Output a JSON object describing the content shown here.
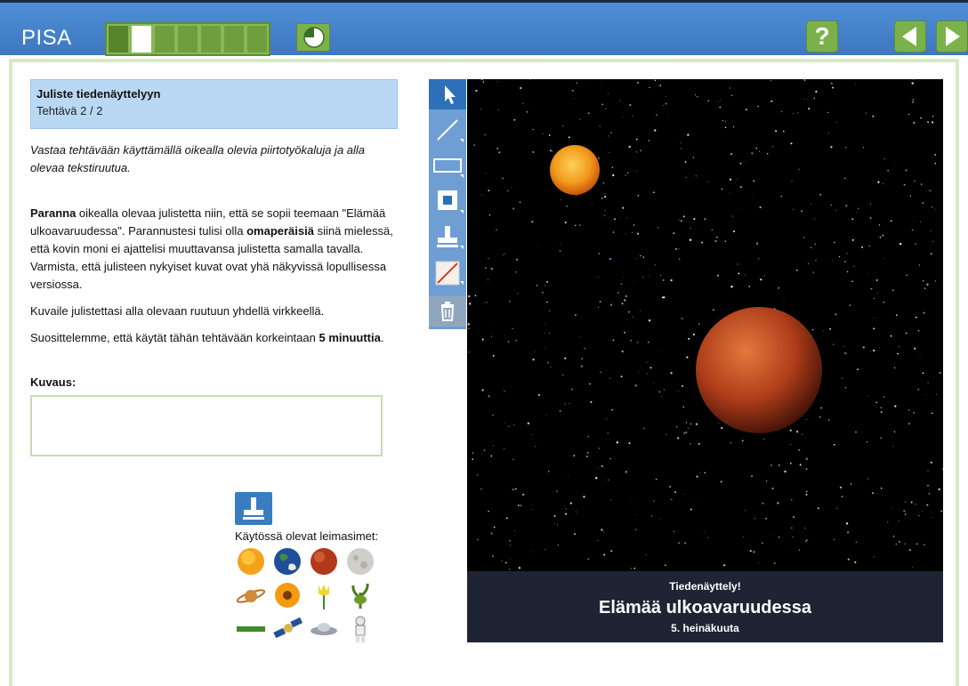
{
  "header": {
    "title": "PISA",
    "progress": {
      "total": 7,
      "completed": 1,
      "current": 2
    },
    "help_label": "?"
  },
  "task": {
    "title": "Juliste tiedenäyttelyyn",
    "subtitle": "Tehtävä 2 / 2",
    "instruction": "Vastaa tehtävään käyttämällä oikealla olevia piirtotyökaluja ja alla olevaa tekstiruutua.",
    "p1_bold1": "Paranna",
    "p1_text1": " oikealla olevaa julistetta niin, että se sopii teemaan \"Elämää ulkoavaruudessa\". Parannustesi tulisi olla ",
    "p1_bold2": "omaperäisiä",
    "p1_text2": " siinä mielessä, että kovin moni ei ajattelisi muuttavansa julistetta samalla tavalla. Varmista, että julisteen nykyiset kuvat ovat yhä näkyvissä lopullisessa versiossa.",
    "p2": "Kuvaile julistettasi alla olevaan ruutuun yhdellä virkkeellä.",
    "p3_text": "Suosittelemme, että käytät tähän tehtävään korkeintaan ",
    "p3_bold": "5 minuuttia",
    "p3_end": ".",
    "description_label": "Kuvaus:",
    "description_value": ""
  },
  "stamps": {
    "label": "Käytössä olevat leimasimet:",
    "items": [
      "sun",
      "earth",
      "mars",
      "moon",
      "saturn",
      "orange-flower",
      "tulip",
      "green-plant",
      "green-bar",
      "satellite",
      "ufo",
      "astronaut"
    ]
  },
  "tools": [
    "select-arrow",
    "line",
    "rectangle-outline",
    "rectangle-filled",
    "stamp",
    "eraser",
    "trash"
  ],
  "poster": {
    "line1": "Tiedenäyttely!",
    "line2": "Elämää ulkoavaruudessa",
    "line3": "5. heinäkuuta"
  }
}
